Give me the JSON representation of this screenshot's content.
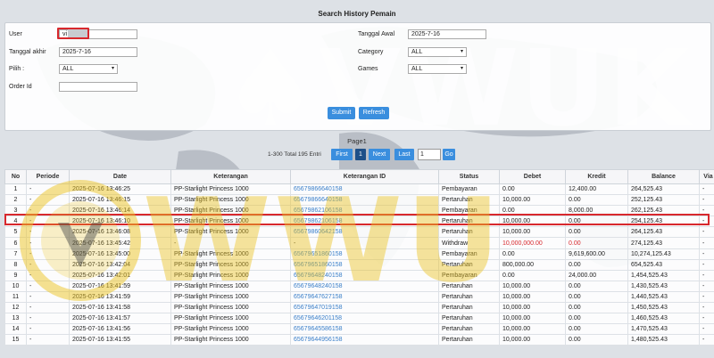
{
  "page_title": "Search History Pemain",
  "form": {
    "user_label": "User",
    "user_value": "vi",
    "tanggal_akhir_label": "Tanggal akhir",
    "tanggal_akhir_value": "2025-7-16",
    "pilih_label": "Pilih :",
    "pilih_value": "ALL",
    "order_id_label": "Order Id",
    "order_id_value": "",
    "tanggal_awal_label": "Tanggal Awal",
    "tanggal_awal_value": "2025-7-16",
    "category_label": "Category",
    "category_value": "ALL",
    "games_label": "Games",
    "games_value": "ALL",
    "submit_label": "Submit",
    "refresh_label": "Refresh"
  },
  "pager": {
    "title": "Page1",
    "info": "1-300 Total 195 Entri",
    "first": "First",
    "current": "1",
    "next": "Next",
    "last": "Last",
    "input": "1",
    "go": "Go"
  },
  "table": {
    "headers": [
      "No",
      "Periode",
      "Date",
      "Keterangan",
      "Keterangan ID",
      "Status",
      "Debet",
      "Kredit",
      "Balance",
      "Via"
    ],
    "rows": [
      [
        "1",
        "-",
        "2025-07-16 13:46:25",
        "PP-Starlight Princess 1000",
        "65679866640158",
        "Pembayaran",
        "0.00",
        "12,400.00",
        "264,525.43",
        "-"
      ],
      [
        "2",
        "-",
        "2025-07-16 13:46:15",
        "PP-Starlight Princess 1000",
        "65679866640158",
        "Pertaruhan",
        "10,000.00",
        "0.00",
        "252,125.43",
        "-"
      ],
      [
        "3",
        "-",
        "2025-07-16 13:46:14",
        "PP-Starlight Princess 1000",
        "65679862106158",
        "Pembayaran",
        "0.00",
        "8,000.00",
        "262,125.43",
        "-"
      ],
      [
        "4",
        "-",
        "2025-07-16 13:46:10",
        "PP-Starlight Princess 1000",
        "65679862106158",
        "Pertaruhan",
        "10,000.00",
        "0.00",
        "254,125.43",
        "-"
      ],
      [
        "5",
        "-",
        "2025-07-16 13:46:08",
        "PP-Starlight Princess 1000",
        "65679860642158",
        "Pertaruhan",
        "10,000.00",
        "0.00",
        "264,125.43",
        "-"
      ],
      [
        "6",
        "-",
        "2025-07-16 13:45:42",
        "-",
        "-",
        "Withdraw",
        "10,000,000.00",
        "0.00",
        "274,125.43",
        "-"
      ],
      [
        "7",
        "-",
        "2025-07-16 13:45:00",
        "PP-Starlight Princess 1000",
        "65679651860158",
        "Pembayaran",
        "0.00",
        "9,619,600.00",
        "10,274,125.43",
        "-"
      ],
      [
        "8",
        "-",
        "2025-07-16 13:42:04",
        "PP-Starlight Princess 1000",
        "65679651860158",
        "Pertaruhan",
        "800,000.00",
        "0.00",
        "654,525.43",
        "-"
      ],
      [
        "9",
        "-",
        "2025-07-16 13:42:01",
        "PP-Starlight Princess 1000",
        "65679648240158",
        "Pembayaran",
        "0.00",
        "24,000.00",
        "1,454,525.43",
        "-"
      ],
      [
        "10",
        "-",
        "2025-07-16 13:41:59",
        "PP-Starlight Princess 1000",
        "65679648240158",
        "Pertaruhan",
        "10,000.00",
        "0.00",
        "1,430,525.43",
        "-"
      ],
      [
        "11",
        "-",
        "2025-07-16 13:41:59",
        "PP-Starlight Princess 1000",
        "65679647627158",
        "Pertaruhan",
        "10,000.00",
        "0.00",
        "1,440,525.43",
        "-"
      ],
      [
        "12",
        "-",
        "2025-07-16 13:41:58",
        "PP-Starlight Princess 1000",
        "65679647019158",
        "Pertaruhan",
        "10,000.00",
        "0.00",
        "1,450,525.43",
        "-"
      ],
      [
        "13",
        "-",
        "2025-07-16 13:41:57",
        "PP-Starlight Princess 1000",
        "65679646201158",
        "Pertaruhan",
        "10,000.00",
        "0.00",
        "1,460,525.43",
        "-"
      ],
      [
        "14",
        "-",
        "2025-07-16 13:41:56",
        "PP-Starlight Princess 1000",
        "65679645586158",
        "Pertaruhan",
        "10,000.00",
        "0.00",
        "1,470,525.43",
        "-"
      ],
      [
        "15",
        "-",
        "2025-07-16 13:41:55",
        "PP-Starlight Princess 1000",
        "65679644956158",
        "Pertaruhan",
        "10,000.00",
        "0.00",
        "1,480,525.43",
        "-"
      ]
    ],
    "highlight_row": 5
  },
  "colors": {
    "accent": "#3a8ede",
    "highlight": "#d8282d",
    "link": "#3a7fc9"
  }
}
